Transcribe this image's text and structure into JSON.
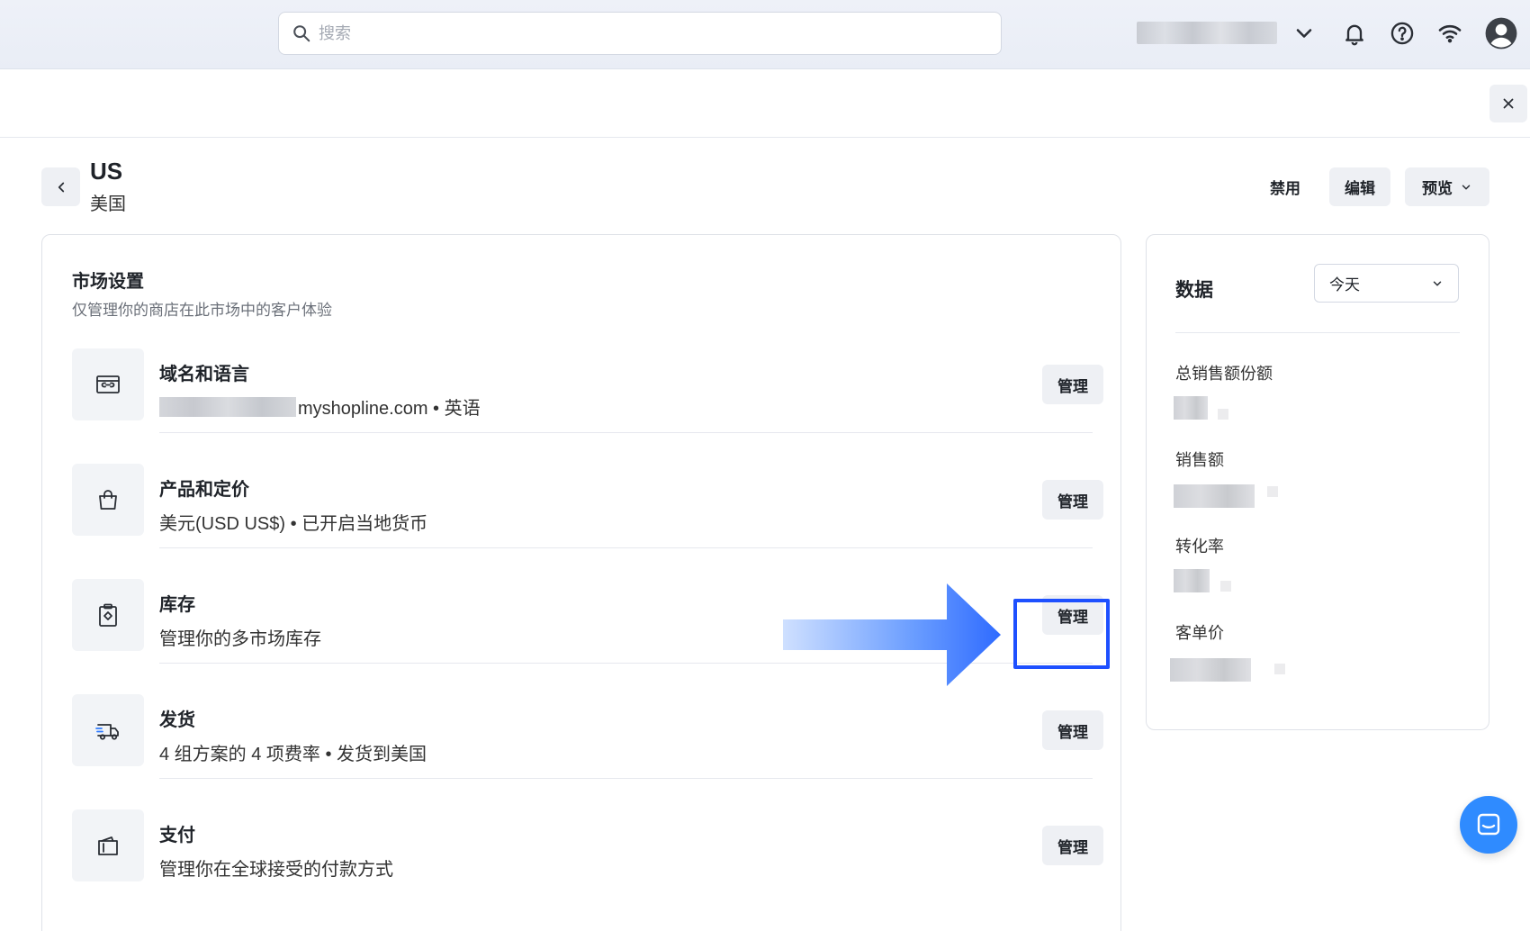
{
  "topbar": {
    "search_placeholder": "搜索",
    "account_name": ""
  },
  "header": {
    "title": "US",
    "subtitle": "美国",
    "disable_label": "禁用",
    "edit_label": "编辑",
    "preview_label": "预览"
  },
  "market": {
    "title": "市场设置",
    "description": "仅管理你的商店在此市场中的客户体验",
    "rows": [
      {
        "title": "域名和语言",
        "subtitle": "myshopline.com • 英语",
        "icon": "link-card-icon",
        "action": "管理"
      },
      {
        "title": "产品和定价",
        "subtitle": "美元(USD US$) • 已开启当地货币",
        "icon": "shopping-bag-icon",
        "action": "管理"
      },
      {
        "title": "库存",
        "subtitle": "管理你的多市场库存",
        "icon": "clipboard-icon",
        "action": "管理"
      },
      {
        "title": "发货",
        "subtitle": "4 组方案的 4 项费率 • 发货到美国",
        "icon": "truck-icon",
        "action": "管理"
      },
      {
        "title": "支付",
        "subtitle": "管理你在全球接受的付款方式",
        "icon": "wallet-icon",
        "action": "管理"
      }
    ]
  },
  "data_panel": {
    "title": "数据",
    "range": "今天",
    "metrics": [
      {
        "label": "总销售额份额"
      },
      {
        "label": "销售额"
      },
      {
        "label": "转化率"
      },
      {
        "label": "客单价"
      }
    ]
  },
  "colors": {
    "highlight": "#1e50ff",
    "chat": "#2f8bff"
  }
}
